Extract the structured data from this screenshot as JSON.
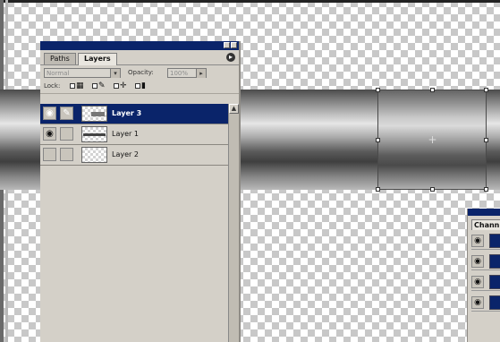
{
  "layers_panel": {
    "tabs": [
      {
        "label": "Paths",
        "active": false
      },
      {
        "label": "Layers",
        "active": true
      }
    ],
    "blend_mode": "Normal",
    "opacity_label": "Opacity:",
    "opacity_value": "100%",
    "lock_label": "Lock:",
    "layers": [
      {
        "name": "Layer 3",
        "visible": true,
        "selected": true,
        "brush": true
      },
      {
        "name": "Layer 1",
        "visible": true,
        "selected": false,
        "brush": false
      },
      {
        "name": "Layer 2",
        "visible": false,
        "selected": false,
        "brush": false
      }
    ]
  },
  "channels_panel": {
    "tab_label": "Chann"
  },
  "colors": {
    "selection_blue": "#0a246a",
    "panel_bg": "#d4d0c8"
  },
  "icons": {
    "eye": "eye-icon",
    "brush": "brush-icon",
    "lock": "lock-icon",
    "move": "move-icon"
  }
}
